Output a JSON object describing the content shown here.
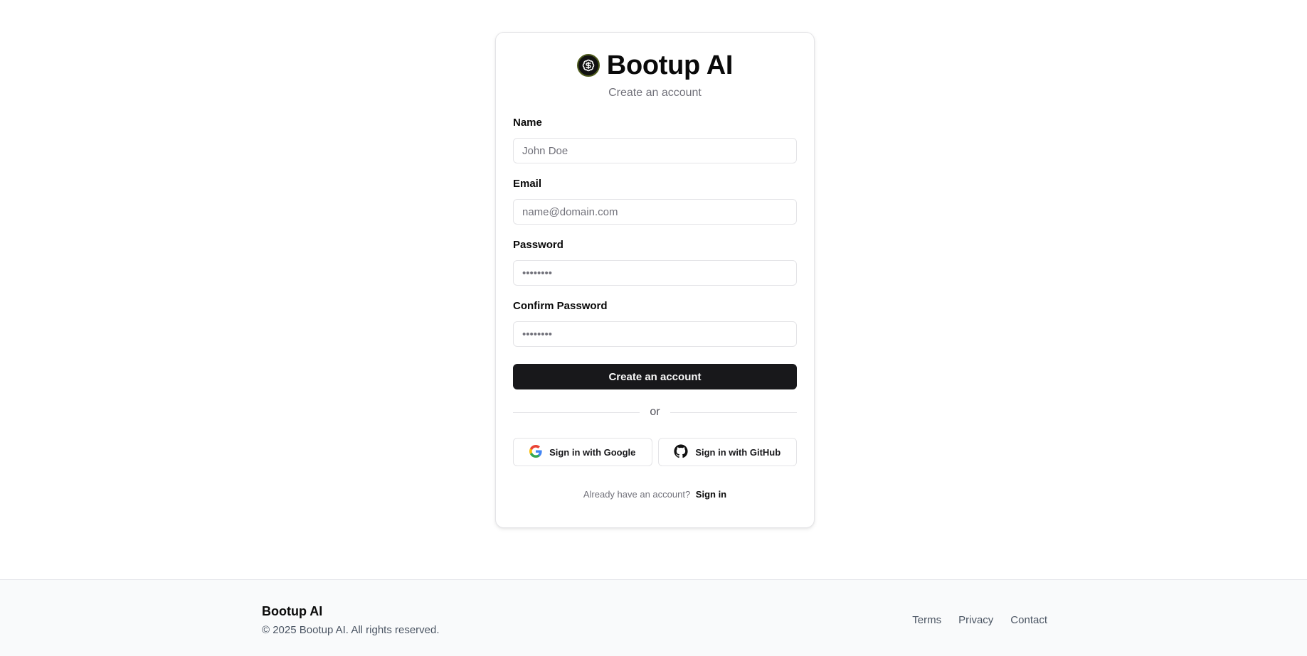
{
  "brand": {
    "name": "Bootup AI",
    "logo_icon": "badge-dollar-icon"
  },
  "form": {
    "subtitle": "Create an account",
    "fields": [
      {
        "label": "Name",
        "placeholder": "John Doe",
        "type": "text"
      },
      {
        "label": "Email",
        "placeholder": "name@domain.com",
        "type": "email"
      },
      {
        "label": "Password",
        "placeholder": "••••••••",
        "type": "password"
      },
      {
        "label": "Confirm Password",
        "placeholder": "••••••••",
        "type": "password"
      }
    ],
    "submit_label": "Create an account",
    "divider_text": "or",
    "google_label": "Sign in with Google",
    "github_label": "Sign in with GitHub",
    "have_account_text": "Already have an account?",
    "signin_link": "Sign in"
  },
  "footer": {
    "brand": "Bootup AI",
    "copyright": "© 2025 Bootup AI. All rights reserved.",
    "links": [
      "Terms",
      "Privacy",
      "Contact"
    ]
  },
  "colors": {
    "primary": "#18181b",
    "muted_text": "#71717a",
    "border": "#e4e4e7",
    "footer_bg": "#f9fafb"
  }
}
